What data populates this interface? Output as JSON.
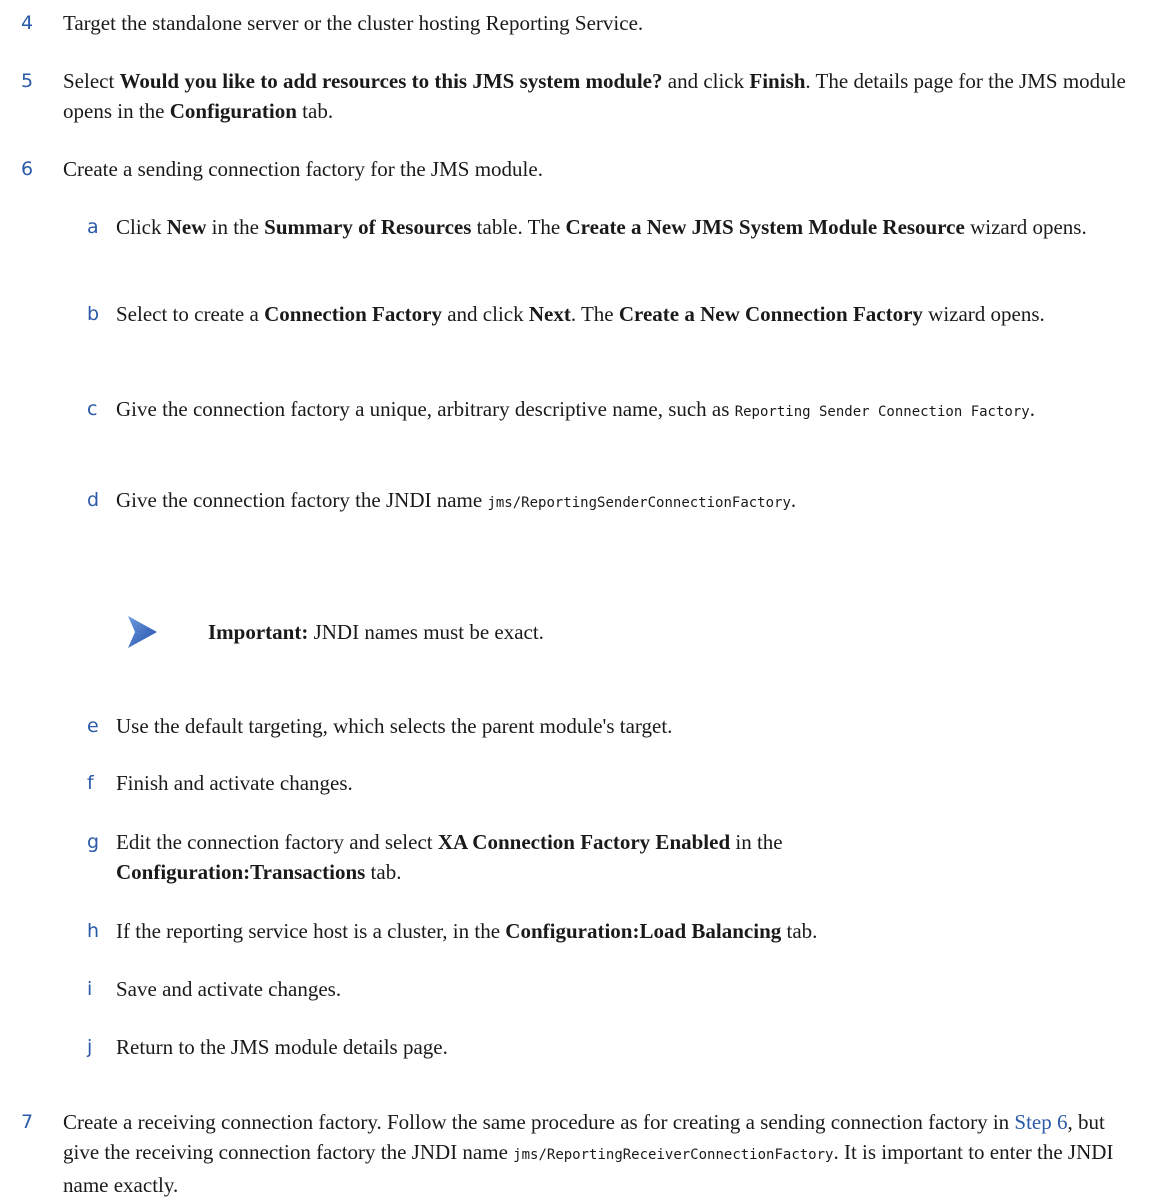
{
  "steps": {
    "s4": {
      "num": "4",
      "text": "Target the standalone server or the cluster hosting Reporting Service."
    },
    "s5": {
      "num": "5",
      "pre": "Select ",
      "bold1": "Would you like to add resources to this JMS system module?",
      "mid1": " and click ",
      "bold2": "Finish",
      "mid2": ". The details page for the JMS module opens in the ",
      "bold3": "Configuration",
      "post": " tab."
    },
    "s6": {
      "num": "6",
      "text": "Create a sending connection factory for the JMS module."
    },
    "s7": {
      "num": "7",
      "pre": "Create a receiving connection factory. Follow the same procedure as for creating a sending connection factory in ",
      "link": "Step 6",
      "mid": ", but give the receiving connection factory the JNDI name ",
      "code": "jms/ReportingReceiverConnectionFactory",
      "post": ". It is important to enter the JNDI name exactly."
    }
  },
  "substeps": {
    "a": {
      "letter": "a",
      "pre": "Click ",
      "bold1": "New",
      "mid1": " in the ",
      "bold2": "Summary of Resources",
      "mid2": " table. The ",
      "bold3": "Create a New JMS System Module Resource",
      "post": " wizard opens."
    },
    "b": {
      "letter": "b",
      "pre": "Select to create a ",
      "bold1": "Connection Factory",
      "mid1": " and click ",
      "bold2": "Next",
      "mid2": ". The ",
      "bold3": "Create a New Connection Factory",
      "post": " wizard opens."
    },
    "c": {
      "letter": "c",
      "pre": "Give the connection factory a unique, arbitrary descriptive name, such as ",
      "code": "Reporting Sender Connection Factory",
      "post": "."
    },
    "d": {
      "letter": "d",
      "pre": "Give the connection factory the JNDI name ",
      "code": "jms/ReportingSenderConnectionFactory",
      "post": "."
    },
    "e": {
      "letter": "e",
      "text": "Use the default targeting, which selects the parent module's target."
    },
    "f": {
      "letter": "f",
      "text": "Finish and activate changes."
    },
    "g": {
      "letter": "g",
      "pre": "Edit the connection factory and select ",
      "bold1": "XA Connection Factory Enabled",
      "mid1": " in the ",
      "bold2": "Configuration:Transactions",
      "post": " tab."
    },
    "h": {
      "letter": "h",
      "pre": "If the reporting service host is a cluster, in the ",
      "bold1": "Configuration:Load Balancing",
      "post": " tab."
    },
    "i": {
      "letter": "i",
      "text": "Save and activate changes."
    },
    "j": {
      "letter": "j",
      "text": "Return to the JMS module details page."
    }
  },
  "important": {
    "label": "Important:",
    "text": " JNDI names must be exact.",
    "icon": "arrow-right-icon",
    "color": "#2a5aa8"
  }
}
